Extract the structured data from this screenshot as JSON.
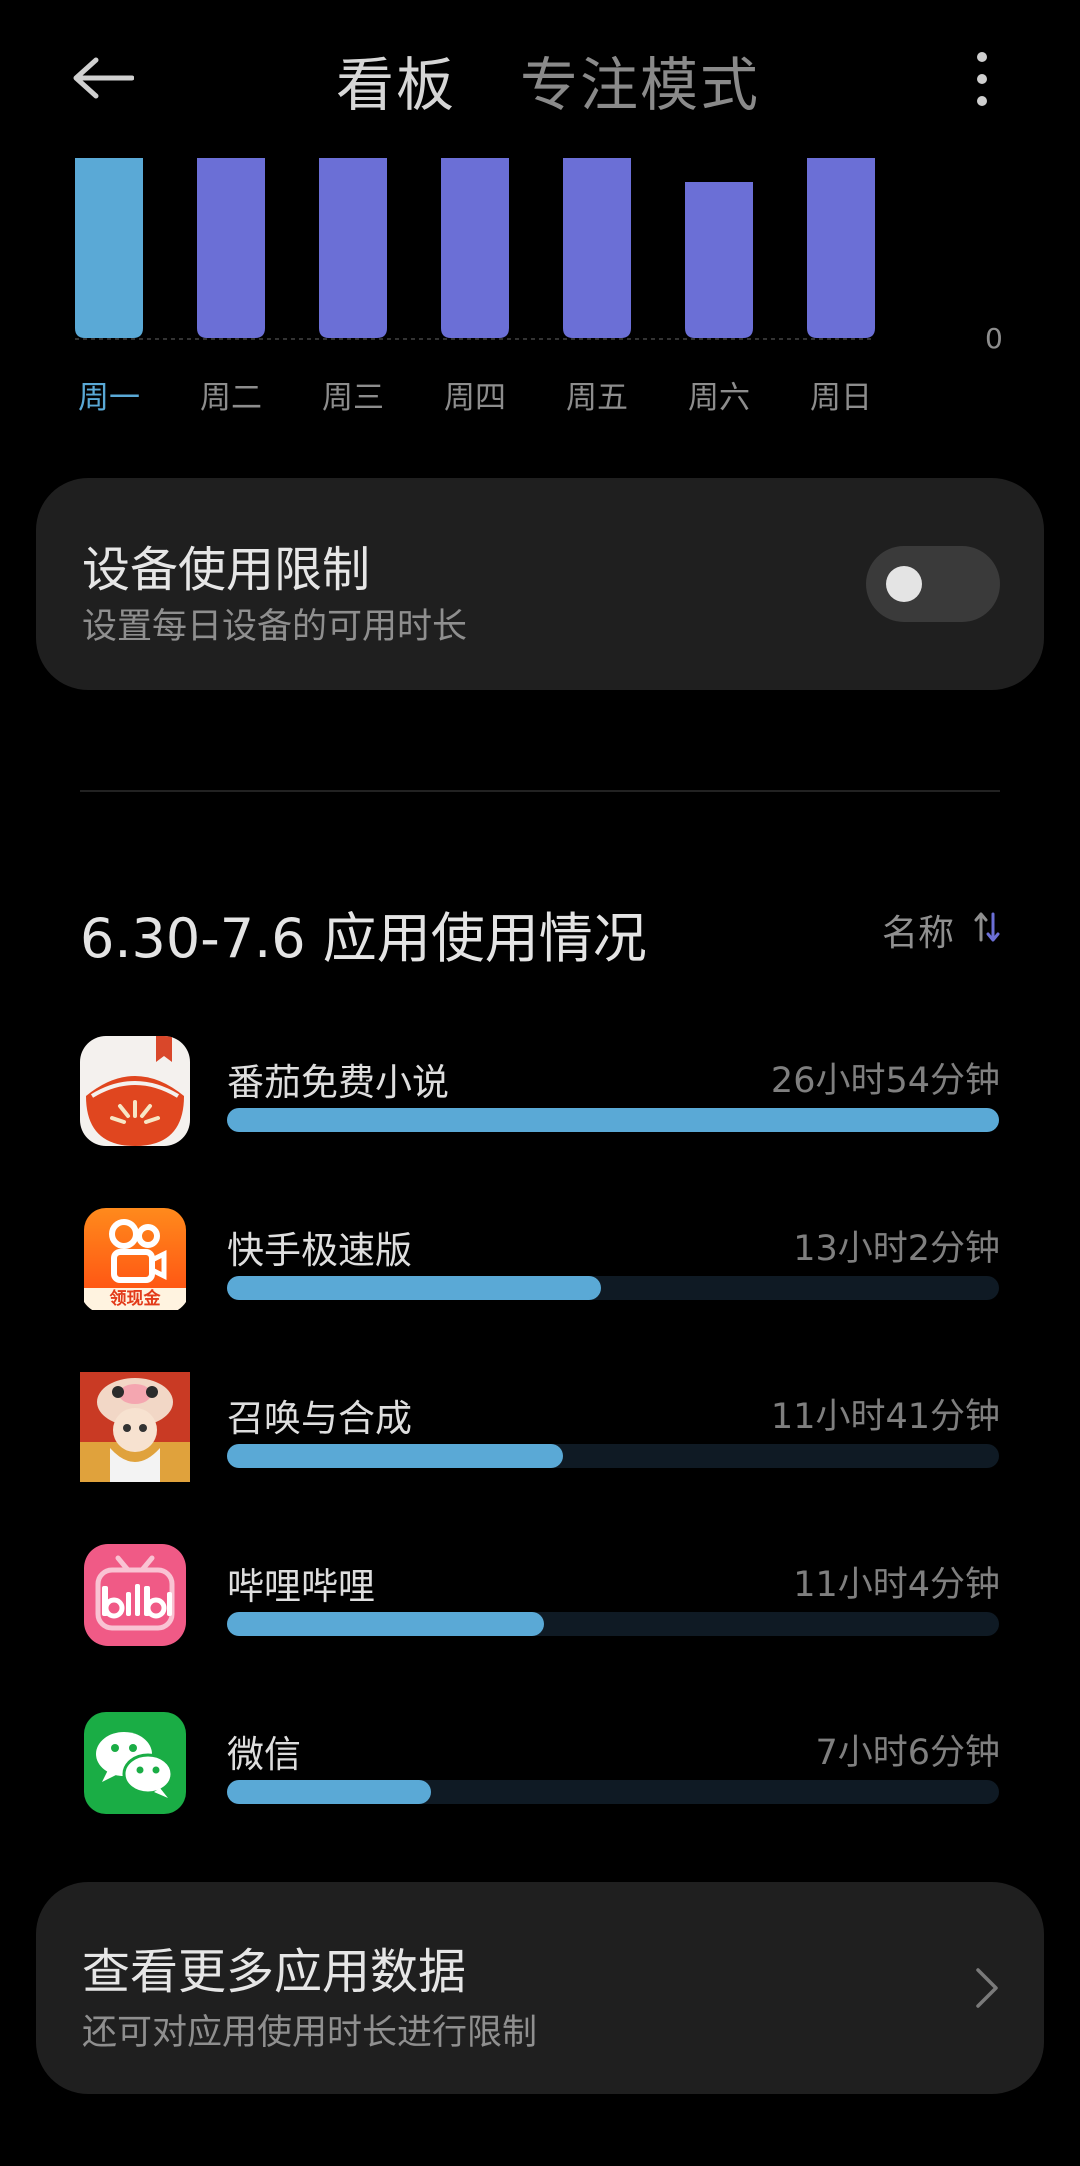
{
  "header": {
    "tabs": [
      "看板",
      "专注模式"
    ]
  },
  "chart_data": {
    "type": "bar",
    "categories": [
      "周一",
      "周二",
      "周三",
      "周四",
      "周五",
      "周六",
      "周日"
    ],
    "values": [
      null,
      null,
      null,
      null,
      null,
      null,
      null
    ],
    "active_index": 0,
    "axis_min_label": "0",
    "colors": {
      "active": "#5aa9d6",
      "normal": "#6b6fd6"
    }
  },
  "device_limit": {
    "title": "设备使用限制",
    "subtitle": "设置每日设备的可用时长",
    "toggle_on": false
  },
  "usage": {
    "title": "6.30-7.6 应用使用情况",
    "sort_label": "名称",
    "apps": [
      {
        "name": "番茄免费小说",
        "time": "26小时54分钟",
        "fraction": 1.0,
        "icon": "tomato-novel-icon"
      },
      {
        "name": "快手极速版",
        "time": "13小时2分钟",
        "fraction": 0.485,
        "icon": "kuaishou-icon"
      },
      {
        "name": "召唤与合成",
        "time": "11小时41分钟",
        "fraction": 0.435,
        "icon": "summon-merge-icon"
      },
      {
        "name": "哔哩哔哩",
        "time": "11小时4分钟",
        "fraction": 0.411,
        "icon": "bilibili-icon"
      },
      {
        "name": "微信",
        "time": "7小时6分钟",
        "fraction": 0.264,
        "icon": "wechat-icon"
      }
    ],
    "kuaishou_badge": "领现金"
  },
  "more_data": {
    "title": "查看更多应用数据",
    "subtitle": "还可对应用使用时长进行限制"
  }
}
